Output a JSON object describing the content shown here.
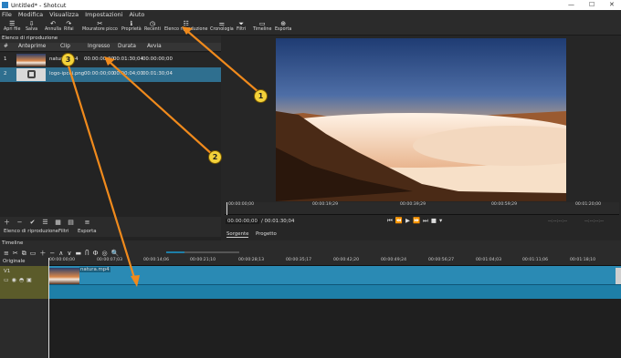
{
  "window": {
    "title": "Untitled* - Shotcut",
    "minimize": "—",
    "maximize": "☐",
    "close": "✕"
  },
  "menu": [
    "File",
    "Modifica",
    "Visualizza",
    "Impostazioni",
    "Aiuto"
  ],
  "toolbar": [
    {
      "icon": "☰",
      "label": "Apri file"
    },
    {
      "icon": "⇩",
      "label": "Salva"
    },
    {
      "icon": "↶",
      "label": "Annulla"
    },
    {
      "icon": "↷",
      "label": "Rifai"
    },
    {
      "icon": "✂",
      "label": "Mouratore picco"
    },
    {
      "icon": "ℹ",
      "label": "Proprietà"
    },
    {
      "icon": "◷",
      "label": "Recenti"
    },
    {
      "icon": "☷",
      "label": "Elenco riproduzione"
    },
    {
      "icon": "⚌",
      "label": "Cronologia"
    },
    {
      "icon": "⏷",
      "label": "Filtri"
    },
    {
      "icon": "▭",
      "label": "Timeline"
    },
    {
      "icon": "⊕",
      "label": "Esporta"
    }
  ],
  "playlist": {
    "header": "Elenco di riproduzione",
    "columns": [
      "#",
      "Anteprime",
      "Clip",
      "Ingresso",
      "Durata",
      "Avvia"
    ],
    "rows": [
      {
        "num": "1",
        "clip": "natura.mp4",
        "in": "00:00:00;00",
        "duration": "00:01:30;04",
        "start": "00:00:00;00"
      },
      {
        "num": "2",
        "clip": "logo-ipcei.png",
        "in": "00:00:00;00",
        "duration": "00:00:04;00",
        "start": "00:01:30;04"
      }
    ],
    "tabs": [
      "Elenco di riproduzione",
      "Filtri",
      "Esporta"
    ]
  },
  "viewer": {
    "ruler_ticks": [
      "00:00:00;00",
      "00:00:19;29",
      "00:00:39;29",
      "00:00:59;29",
      "00:01:20;00"
    ],
    "current": "00:00:00;00",
    "total": "/ 00:01:30;04",
    "in_point": "--:--:--:--",
    "out_point": "--:--:--:--",
    "tabs": [
      "Sorgente",
      "Progetto"
    ]
  },
  "timeline": {
    "label": "Timeline",
    "track_header": "Originale",
    "track": "V1",
    "ticks": [
      "00:00:00;00",
      "00:00:07;03",
      "00:00:14;06",
      "00:00:21;10",
      "00:00:28;13",
      "00:00:35;17",
      "00:00:42;20",
      "00:00:49;24",
      "00:00:56;27",
      "00:01:04;03",
      "00:01:11;06",
      "00:01:18;10"
    ],
    "clip_label": "natura.mp4"
  },
  "callouts": [
    "1",
    "2",
    "3"
  ],
  "colors": {
    "accent": "#1e7fa8",
    "selection": "#2f6f8f",
    "callout": "#f4d23a",
    "arrow": "#f08a1c",
    "track_header": "#5b5b2a"
  }
}
